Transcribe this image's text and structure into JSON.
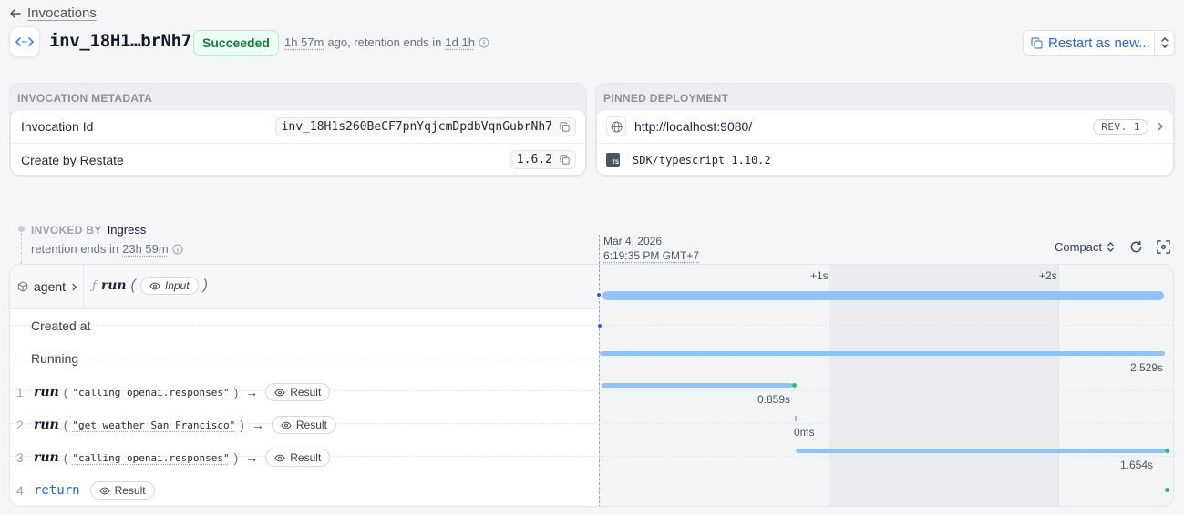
{
  "header": {
    "back_label": "Invocations",
    "invocation_title": "inv_18H1…brNh7",
    "status": "Succeeded",
    "age": "1h 57m",
    "age_suffix": "ago, retention ends in",
    "retention": "1d 1h",
    "restart_label": "Restart as new..."
  },
  "metadata": {
    "title": "INVOCATION METADATA",
    "rows": [
      {
        "label": "Invocation Id",
        "value": "inv_18H1s260BeCF7pnYqjcmDpdbVqnGubrNh7"
      },
      {
        "label": "Create by Restate",
        "value": "1.6.2"
      }
    ]
  },
  "deployment": {
    "title": "PINNED DEPLOYMENT",
    "url": "http://localhost:9080/",
    "revision": "REV. 1",
    "sdk": "SDK/typescript 1.10.2",
    "sdk_badge": "TS"
  },
  "invoked_by": {
    "label": "INVOKED BY",
    "source": "Ingress",
    "retention_prefix": "retention ends in",
    "retention": "23h 59m"
  },
  "timeline": {
    "date": "Mar 4, 2026",
    "time": "6:19:35 PM GMT+7",
    "mode": "Compact",
    "ticks": [
      "+1s",
      "+2s"
    ]
  },
  "service": {
    "name": "agent",
    "handler": "run",
    "input_label": "Input"
  },
  "events": {
    "created_at": "Created at",
    "running": "Running",
    "running_duration": "2.529s"
  },
  "steps": [
    {
      "index": "1",
      "fn": "run",
      "arg": "\"calling openai.responses\"",
      "result": "Result",
      "duration": "0.859s"
    },
    {
      "index": "2",
      "fn": "run",
      "arg": "\"get weather San Francisco\"",
      "result": "Result",
      "duration": "0ms"
    },
    {
      "index": "3",
      "fn": "run",
      "arg": "\"calling openai.responses\"",
      "result": "Result",
      "duration": "1.654s"
    },
    {
      "index": "4",
      "fn": "return",
      "result": "Result"
    }
  ],
  "colors": {
    "accent": "#2563eb",
    "success": "#15803d",
    "bar": "#93c2f5"
  }
}
